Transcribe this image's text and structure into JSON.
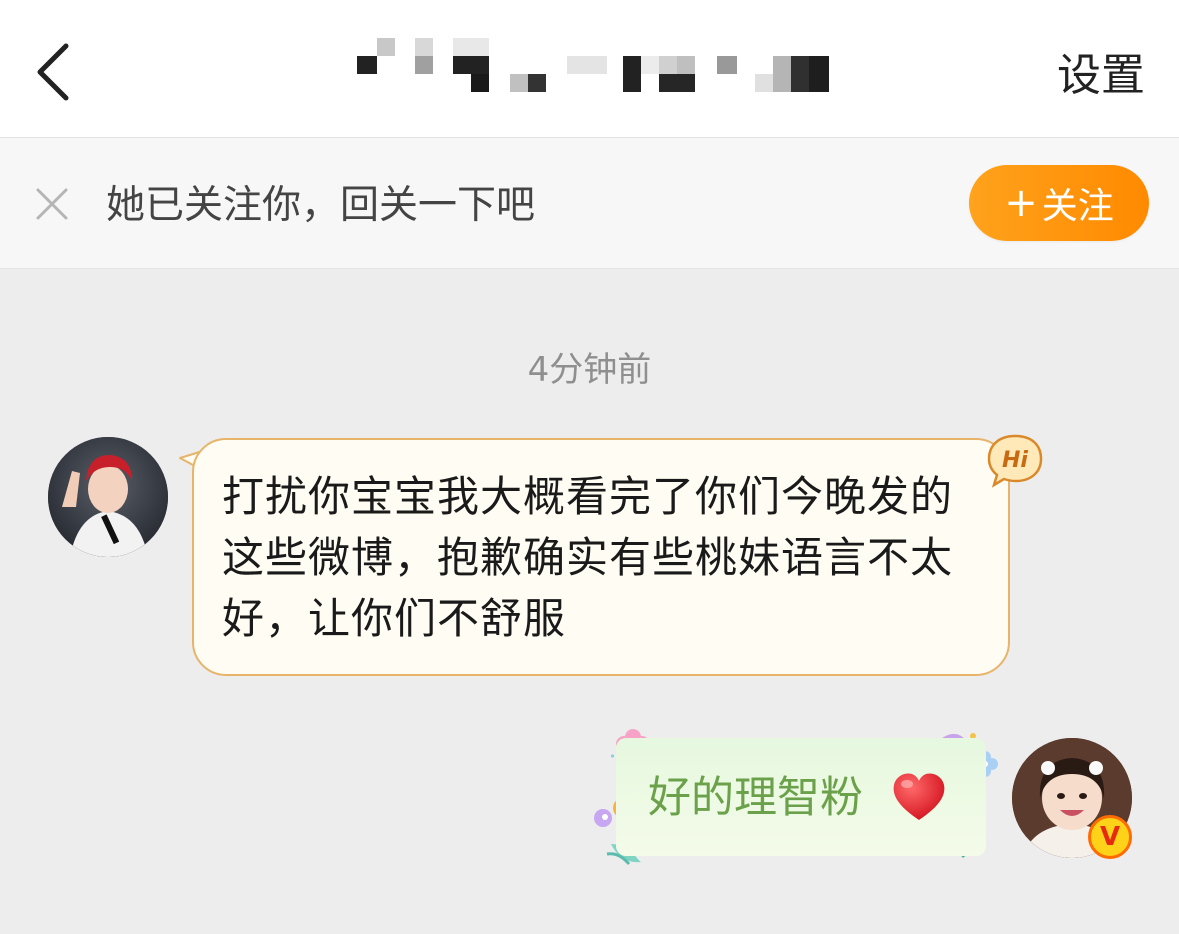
{
  "header": {
    "back_icon": "chevron-left-icon",
    "title_redacted": true,
    "settings_label": "设置"
  },
  "follow_notice": {
    "close_icon": "close-icon",
    "text": "她已关注你，回关一下吧",
    "button_plus": "+",
    "button_label": "关注",
    "button_color": "#ff9410"
  },
  "chat": {
    "timestamp": "4分钟前",
    "messages": [
      {
        "side": "left",
        "avatar": "avatar-photo",
        "text": "打扰你宝宝我大概看完了你们今晚发的这些微博，抱歉确实有些桃妹语言不太好，让你们不舒服",
        "badge_text": "Hi"
      },
      {
        "side": "right",
        "avatar": "avatar-photo",
        "text": "好的理智粉",
        "emoji": "heart-icon",
        "verified_badge": "V"
      }
    ]
  },
  "colors": {
    "bubble_border": "#e7b46a",
    "bubble_fill": "#fffcf3",
    "green_text": "#6ba14a",
    "background": "#ededed"
  }
}
